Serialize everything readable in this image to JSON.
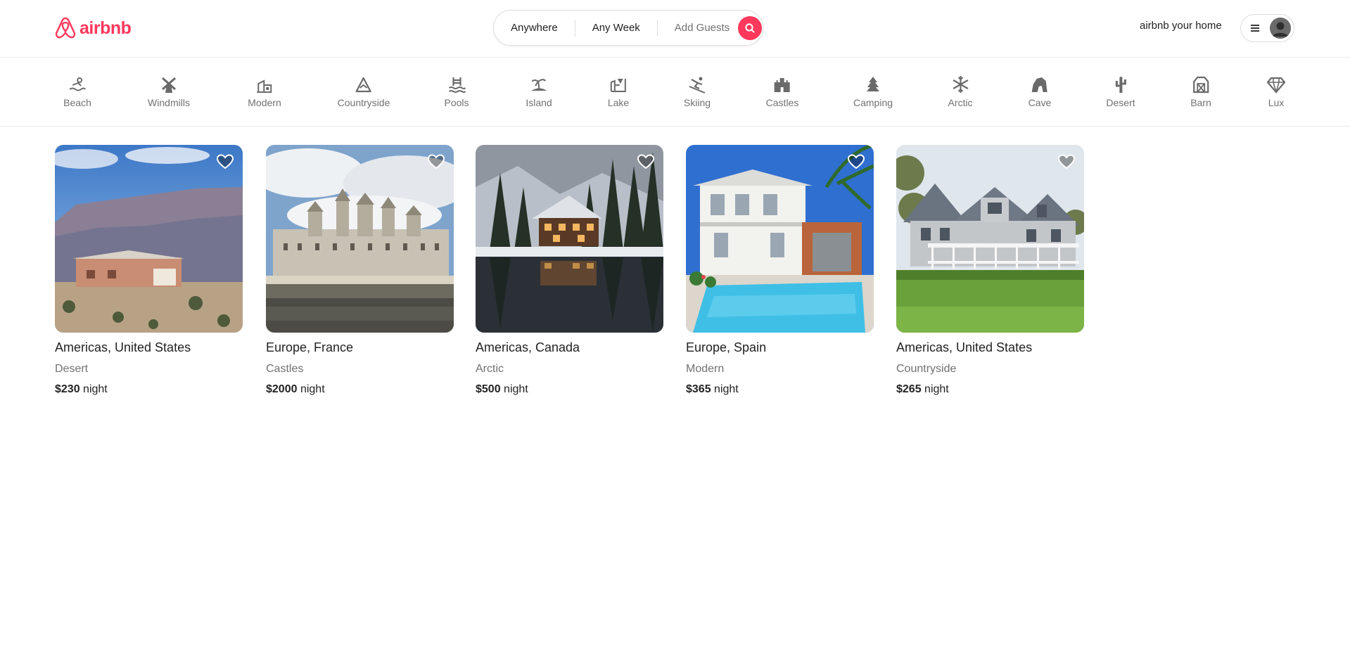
{
  "brand": {
    "name": "airbnb",
    "color": "#FF385C",
    "icon": "airbnb-logo-icon"
  },
  "search": {
    "where": "Anywhere",
    "when": "Any Week",
    "guests": "Add Guests",
    "button_icon": "search-icon"
  },
  "header": {
    "host_link": "airbnb your home",
    "menu_icon": "hamburger-menu-icon",
    "avatar_icon": "user-avatar-icon"
  },
  "categories": [
    {
      "label": "Beach",
      "icon": "beach-icon"
    },
    {
      "label": "Windmills",
      "icon": "windmill-icon"
    },
    {
      "label": "Modern",
      "icon": "modern-house-icon"
    },
    {
      "label": "Countryside",
      "icon": "countryside-icon"
    },
    {
      "label": "Pools",
      "icon": "pool-icon"
    },
    {
      "label": "Island",
      "icon": "island-icon"
    },
    {
      "label": "Lake",
      "icon": "lake-icon"
    },
    {
      "label": "Skiing",
      "icon": "skiing-icon"
    },
    {
      "label": "Castles",
      "icon": "castle-icon"
    },
    {
      "label": "Camping",
      "icon": "camping-icon"
    },
    {
      "label": "Arctic",
      "icon": "snowflake-icon"
    },
    {
      "label": "Cave",
      "icon": "cave-icon"
    },
    {
      "label": "Desert",
      "icon": "cactus-icon"
    },
    {
      "label": "Barn",
      "icon": "barn-icon"
    },
    {
      "label": "Lux",
      "icon": "diamond-icon"
    }
  ],
  "listings": [
    {
      "location": "Americas, United States",
      "category": "Desert",
      "price": "$230",
      "unit": "night",
      "photo": "desert-house-photo"
    },
    {
      "location": "Europe, France",
      "category": "Castles",
      "price": "$2000",
      "unit": "night",
      "photo": "castle-photo"
    },
    {
      "location": "Americas, Canada",
      "category": "Arctic",
      "price": "$500",
      "unit": "night",
      "photo": "snowy-cabin-photo"
    },
    {
      "location": "Europe, Spain",
      "category": "Modern",
      "price": "$365",
      "unit": "night",
      "photo": "villa-pool-photo"
    },
    {
      "location": "Americas, United States",
      "category": "Countryside",
      "price": "$265",
      "unit": "night",
      "photo": "country-house-photo"
    }
  ],
  "colors": {
    "accent": "#FF385C",
    "text": "#222222",
    "muted": "#717171",
    "border": "#dddddd"
  }
}
